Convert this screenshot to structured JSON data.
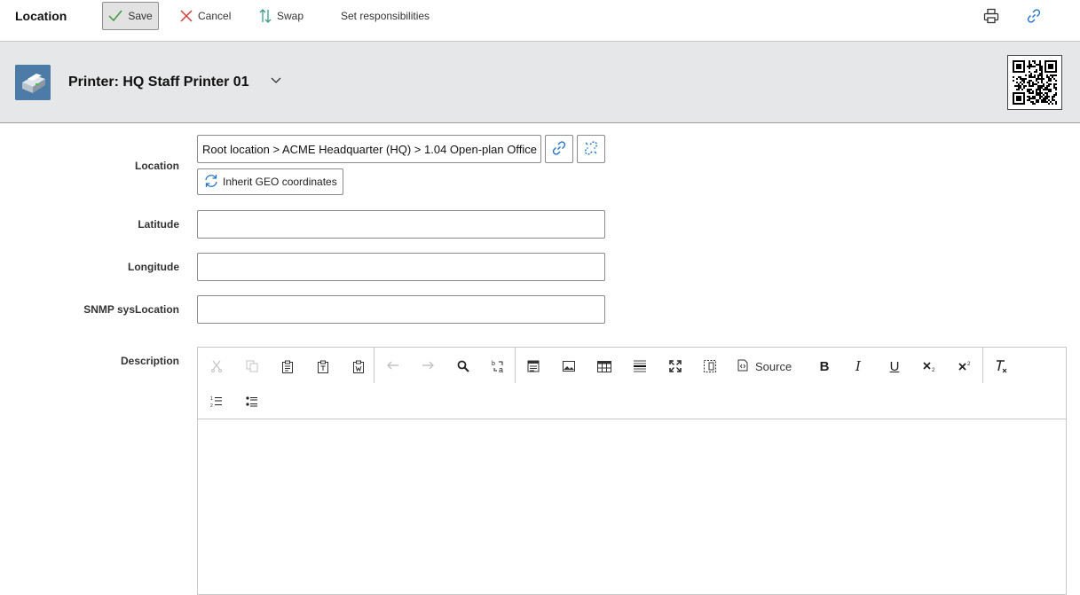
{
  "toolbar": {
    "title": "Location",
    "save_label": "Save",
    "cancel_label": "Cancel",
    "swap_label": "Swap",
    "responsibilities_label": "Set responsibilities",
    "icons": [
      "checkmark-icon",
      "close-icon",
      "swap-icon",
      "print-icon",
      "link-icon"
    ]
  },
  "header": {
    "object_title": "Printer: HQ Staff Printer 01",
    "thumbnail_icon": "printer-icon",
    "qr_icon": "qr-code-icon"
  },
  "form": {
    "location": {
      "label": "Location",
      "value": "Root location > ACME Headquarter (HQ) > 1.04 Open-plan Office",
      "inherit_button_label": "Inherit GEO coordinates"
    },
    "latitude": {
      "label": "Latitude",
      "value": ""
    },
    "longitude": {
      "label": "Longitude",
      "value": ""
    },
    "snmp": {
      "label": "SNMP sysLocation",
      "value": ""
    },
    "description": {
      "label": "Description",
      "source_label": "Source",
      "toolbar_icons": [
        "cut-icon",
        "copy-icon",
        "paste-icon",
        "paste-text-icon",
        "paste-word-icon",
        "undo-icon",
        "redo-icon",
        "find-icon",
        "replace-icon",
        "template-icon",
        "image-icon",
        "table-icon",
        "horizontal-rule-icon",
        "maximize-icon",
        "show-blocks-icon",
        "source-icon",
        "bold-icon",
        "italic-icon",
        "underline-icon",
        "subscript-icon",
        "superscript-icon",
        "remove-format-icon",
        "numbered-list-icon",
        "bulleted-list-icon"
      ]
    }
  },
  "colors": {
    "accent_blue": "#1f73c8",
    "save_green": "#3a9a3a",
    "cancel_red": "#d43b3b",
    "swap_teal": "#3a9a8a"
  }
}
